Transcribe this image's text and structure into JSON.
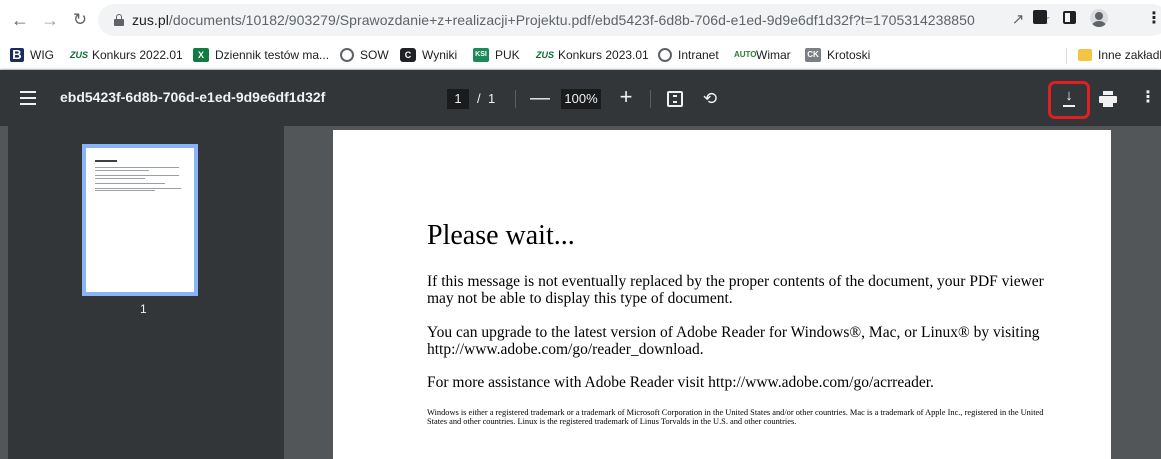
{
  "browser": {
    "url": "zus.pl/documents/10182/903279/Sprawozdanie+z+realizacji+Projektu.pdf/ebd5423f-6d8b-706d-e1ed-9d9e6df1d32f?t=1705314238850",
    "url_host": "zus.pl",
    "url_path": "/documents/10182/903279/Sprawozdanie+z+realizacji+Projektu.pdf/ebd5423f-6d8b-706d-e1ed-9d9e6df1d32f?t=1705314238850"
  },
  "bookmarks": {
    "items": [
      {
        "label": "WIG",
        "icon": "B"
      },
      {
        "label": "Konkurs 2022.01",
        "icon": "ZUS"
      },
      {
        "label": "Dziennik testów ma...",
        "icon": "X"
      },
      {
        "label": "SOW",
        "icon": "globe-icon"
      },
      {
        "label": "Wyniki",
        "icon": "C"
      },
      {
        "label": "PUK",
        "icon": "KSI"
      },
      {
        "label": "Konkurs 2023.01",
        "icon": "ZUS"
      },
      {
        "label": "Intranet",
        "icon": "globe-icon"
      },
      {
        "label": "Wimar",
        "icon": "AUTO"
      },
      {
        "label": "Krotoski",
        "icon": "CK"
      }
    ],
    "other": "Inne zakładki"
  },
  "pdf_toolbar": {
    "title": "ebd5423f-6d8b-706d-e1ed-9d9e6df1d32f",
    "page_current": "1",
    "page_separator": "/",
    "page_total": "1",
    "zoom": "100%"
  },
  "sidebar": {
    "thumbnail_label": "1"
  },
  "document": {
    "heading": "Please wait...",
    "paragraph1": "If this message is not eventually replaced by the proper contents of the document, your PDF viewer may not be able to display this type of document.",
    "paragraph2": "You can upgrade to the latest version of Adobe Reader for Windows®, Mac, or Linux® by visiting  http://www.adobe.com/go/reader_download.",
    "paragraph3": "For more assistance with Adobe Reader visit  http://www.adobe.com/go/acrreader.",
    "legal": "Windows is either a registered trademark or a trademark of Microsoft Corporation in the United States and/or other countries. Mac is a trademark of Apple Inc., registered in the United States and other countries. Linux is the registered trademark of Linus Torvalds in the U.S. and other countries."
  },
  "colors": {
    "toolbar_bg": "#323639",
    "viewer_bg": "#525659",
    "thumbnail_border": "#8ab4f8",
    "highlight": "#e02020"
  }
}
